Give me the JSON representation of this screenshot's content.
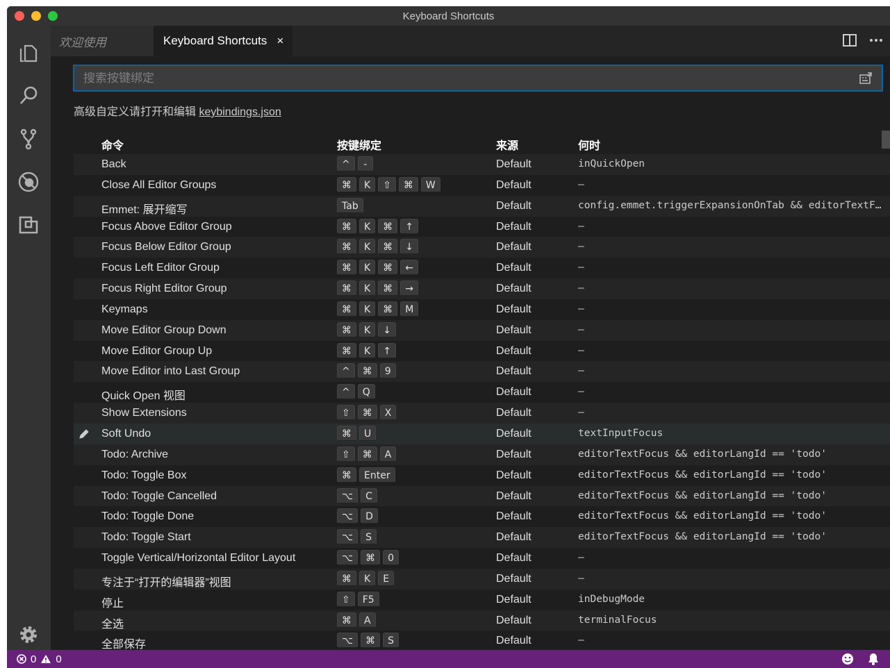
{
  "window": {
    "title": "Keyboard Shortcuts"
  },
  "tabs": [
    {
      "label": "欢迎使用"
    },
    {
      "label": "Keyboard Shortcuts",
      "close": "×"
    }
  ],
  "search": {
    "placeholder": "搜索按键绑定"
  },
  "hint": {
    "text": "高级自定义请打开和编辑 ",
    "link": "keybindings.json"
  },
  "table": {
    "headers": {
      "command": "命令",
      "keybinding": "按键绑定",
      "source": "来源",
      "when": "何时"
    },
    "rows": [
      {
        "command": "Back",
        "keys": [
          "^",
          "-"
        ],
        "source": "Default",
        "when": "inQuickOpen"
      },
      {
        "command": "Close All Editor Groups",
        "keys": [
          "⌘",
          "K",
          "⇧",
          "⌘",
          "W"
        ],
        "source": "Default",
        "when": "—"
      },
      {
        "command": "Emmet: 展开缩写",
        "keys": [
          "Tab"
        ],
        "source": "Default",
        "when": "config.emmet.triggerExpansionOnTab && editorTextFocus"
      },
      {
        "command": "Focus Above Editor Group",
        "keys": [
          "⌘",
          "K",
          "⌘",
          "↑"
        ],
        "source": "Default",
        "when": "—"
      },
      {
        "command": "Focus Below Editor Group",
        "keys": [
          "⌘",
          "K",
          "⌘",
          "↓"
        ],
        "source": "Default",
        "when": "—"
      },
      {
        "command": "Focus Left Editor Group",
        "keys": [
          "⌘",
          "K",
          "⌘",
          "←"
        ],
        "source": "Default",
        "when": "—"
      },
      {
        "command": "Focus Right Editor Group",
        "keys": [
          "⌘",
          "K",
          "⌘",
          "→"
        ],
        "source": "Default",
        "when": "—"
      },
      {
        "command": "Keymaps",
        "keys": [
          "⌘",
          "K",
          "⌘",
          "M"
        ],
        "source": "Default",
        "when": "—"
      },
      {
        "command": "Move Editor Group Down",
        "keys": [
          "⌘",
          "K",
          "↓"
        ],
        "source": "Default",
        "when": "—"
      },
      {
        "command": "Move Editor Group Up",
        "keys": [
          "⌘",
          "K",
          "↑"
        ],
        "source": "Default",
        "when": "—"
      },
      {
        "command": "Move Editor into Last Group",
        "keys": [
          "^",
          "⌘",
          "9"
        ],
        "source": "Default",
        "when": "—"
      },
      {
        "command": "Quick Open 视图",
        "keys": [
          "^",
          "Q"
        ],
        "source": "Default",
        "when": "—"
      },
      {
        "command": "Show Extensions",
        "keys": [
          "⇧",
          "⌘",
          "X"
        ],
        "source": "Default",
        "when": "—"
      },
      {
        "command": "Soft Undo",
        "keys": [
          "⌘",
          "U"
        ],
        "source": "Default",
        "when": "textInputFocus"
      },
      {
        "command": "Todo: Archive",
        "keys": [
          "⇧",
          "⌘",
          "A"
        ],
        "source": "Default",
        "when": "editorTextFocus && editorLangId == 'todo'"
      },
      {
        "command": "Todo: Toggle Box",
        "keys": [
          "⌘",
          "Enter"
        ],
        "source": "Default",
        "when": "editorTextFocus && editorLangId == 'todo'"
      },
      {
        "command": "Todo: Toggle Cancelled",
        "keys": [
          "⌥",
          "C"
        ],
        "source": "Default",
        "when": "editorTextFocus && editorLangId == 'todo'"
      },
      {
        "command": "Todo: Toggle Done",
        "keys": [
          "⌥",
          "D"
        ],
        "source": "Default",
        "when": "editorTextFocus && editorLangId == 'todo'"
      },
      {
        "command": "Todo: Toggle Start",
        "keys": [
          "⌥",
          "S"
        ],
        "source": "Default",
        "when": "editorTextFocus && editorLangId == 'todo'"
      },
      {
        "command": "Toggle Vertical/Horizontal Editor Layout",
        "keys": [
          "⌥",
          "⌘",
          "0"
        ],
        "source": "Default",
        "when": "—"
      },
      {
        "command": "专注于“打开的编辑器”视图",
        "keys": [
          "⌘",
          "K",
          "E"
        ],
        "source": "Default",
        "when": "—"
      },
      {
        "command": "停止",
        "keys": [
          "⇧",
          "F5"
        ],
        "source": "Default",
        "when": "inDebugMode"
      },
      {
        "command": "全选",
        "keys": [
          "⌘",
          "A"
        ],
        "source": "Default",
        "when": "terminalFocus"
      },
      {
        "command": "全部保存",
        "keys": [
          "⌥",
          "⌘",
          "S"
        ],
        "source": "Default",
        "when": "—"
      }
    ]
  },
  "statusbar": {
    "errors": "0",
    "warnings": "0"
  },
  "colors": {
    "accent": "#0e639c",
    "statusbar": "#68217a"
  }
}
